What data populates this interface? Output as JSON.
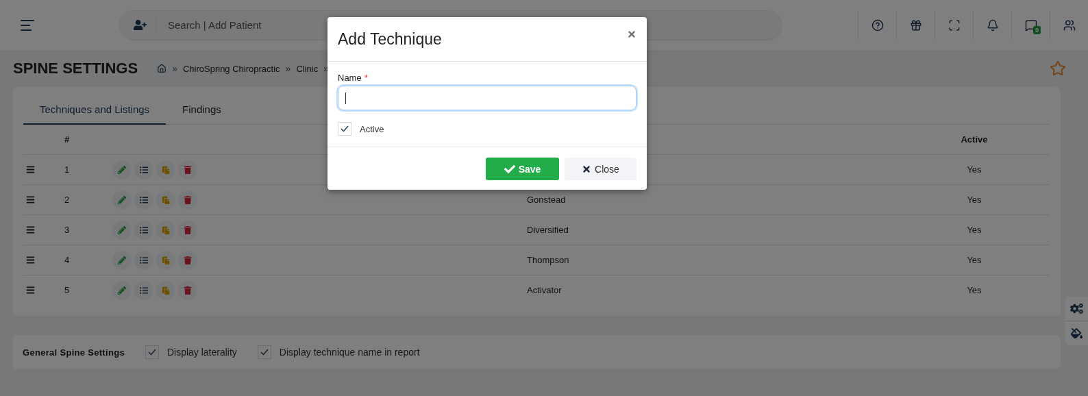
{
  "header": {
    "search_placeholder": "Search | Add Patient",
    "message_badge": "0"
  },
  "page": {
    "title": "SPINE SETTINGS",
    "separator": "»",
    "breadcrumb": [
      "ChiroSpring Chiropractic",
      "Clinic"
    ]
  },
  "tabs": [
    {
      "label": "Techniques and Listings",
      "selected": true
    },
    {
      "label": "Findings",
      "selected": false
    }
  ],
  "table": {
    "columns": {
      "number": "#",
      "active": "Active"
    },
    "rows": [
      {
        "number": "1",
        "active": "Yes"
      },
      {
        "number": "2",
        "name": "Gonstead",
        "active": "Yes"
      },
      {
        "number": "3",
        "name": "Diversified",
        "active": "Yes"
      },
      {
        "number": "4",
        "name": "Thompson",
        "active": "Yes"
      },
      {
        "number": "5",
        "name": "Activator",
        "active": "Yes"
      }
    ]
  },
  "general_settings": {
    "label": "General Spine Settings",
    "options": [
      {
        "label": "Display laterality",
        "checked": true
      },
      {
        "label": "Display technique name in report",
        "checked": true
      }
    ]
  },
  "modal": {
    "title": "Add Technique",
    "field": {
      "label": "Name",
      "required_mark": "*",
      "focused": true
    },
    "active": {
      "label": "Active",
      "checked": true
    },
    "buttons": [
      {
        "label": "Save",
        "kind": "primary"
      },
      {
        "label": "Close",
        "kind": "secondary"
      }
    ]
  }
}
